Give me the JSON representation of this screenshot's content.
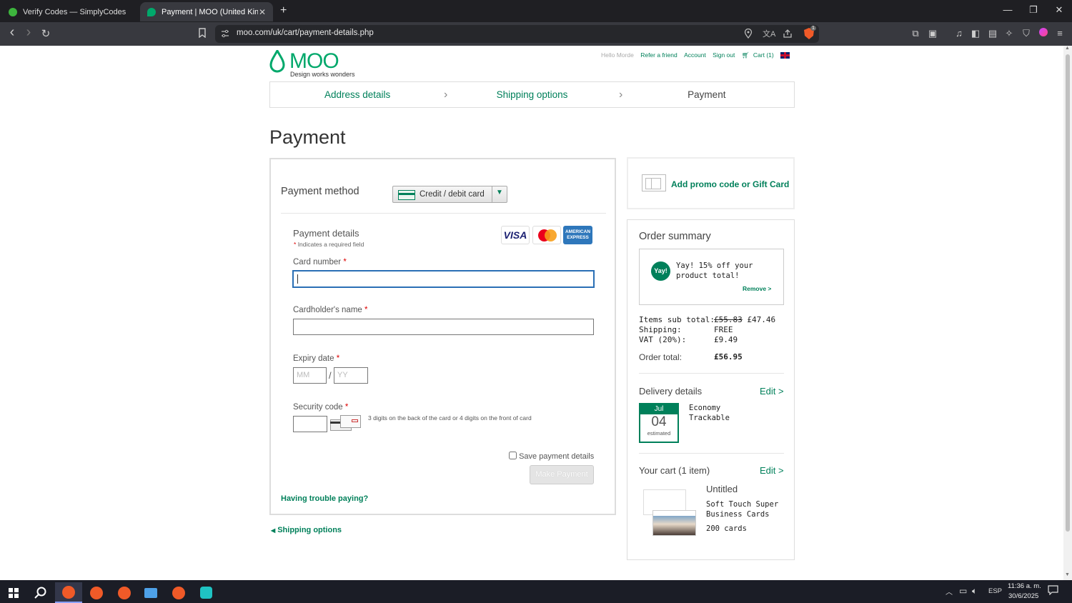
{
  "browser": {
    "tabs": [
      {
        "title": "Verify Codes — SimplyCodes",
        "active": false,
        "fav_color": "#3db53d"
      },
      {
        "title": "Payment | MOO (United Kingdom)",
        "active": true,
        "fav_color": "#00a86b",
        "close": "✕"
      }
    ],
    "new_tab": "+",
    "url": "moo.com/uk/cart/payment-details.php",
    "window": {
      "minimize": "—",
      "restore": "❐",
      "close": "✕"
    },
    "nav": {
      "back": "‹",
      "forward": "›",
      "reload": "↻",
      "bookmark": "🔖"
    },
    "shield_count": "1"
  },
  "site": {
    "logo_text": "MOO",
    "tagline": "Design works wonders",
    "header_links": {
      "hello": "Hello Morde",
      "refer": "Refer a friend",
      "account": "Account",
      "signout": "Sign out",
      "cart": "Cart (1)"
    },
    "steps": [
      "Address details",
      "Shipping options",
      "Payment"
    ],
    "title": "Payment"
  },
  "payment": {
    "method_label": "Payment method",
    "method_value": "Credit / debit card",
    "details_title": "Payment details",
    "required_note": "Indicates a required field",
    "card_brands": [
      "VISA",
      "Mastercard",
      "AMERICAN EXPRESS"
    ],
    "card_number_label": "Card number",
    "card_number_value": "",
    "cardholder_label": "Cardholder's name",
    "cardholder_value": "",
    "expiry_label": "Expiry date",
    "expiry_mm_placeholder": "MM",
    "expiry_yy_placeholder": "YY",
    "expiry_sep": "/",
    "security_label": "Security code",
    "security_hint": "3 digits on the back of the card or 4 digits on the front of card",
    "save_label": "Save payment details",
    "make_payment": "Make Payment",
    "trouble": "Having trouble paying?",
    "back_link": "Shipping options",
    "asterisk": "*"
  },
  "promo": {
    "label": "Add promo code or Gift Card"
  },
  "summary": {
    "title": "Order summary",
    "badge": "Yay!",
    "discount_text": "Yay! 15% off your product total!",
    "remove": "Remove >",
    "rows": [
      {
        "label": "Items sub total:",
        "old": "£55.83",
        "value": "£47.46"
      },
      {
        "label": "Shipping:",
        "value": "FREE"
      },
      {
        "label": "VAT (20%):",
        "value": "£9.49"
      }
    ],
    "total_label": "Order total:",
    "total_value": "£56.95",
    "delivery_title": "Delivery details",
    "edit": "Edit >",
    "date_month": "Jul",
    "date_day": "04",
    "date_note": "estimated",
    "delivery_method": "Economy Trackable",
    "cart_title": "Your cart (1 item)",
    "item_name": "Untitled",
    "item_product": "Soft Touch Super Business Cards",
    "item_qty": "200 cards"
  },
  "taskbar": {
    "lang": "ESP",
    "time": "11:36 a. m.",
    "date": "30/6/2025"
  }
}
